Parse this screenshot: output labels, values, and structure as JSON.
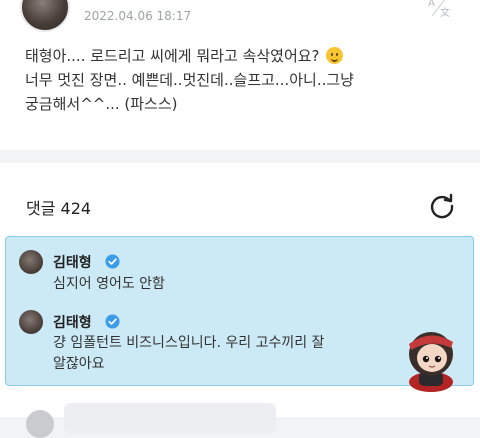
{
  "post": {
    "author": "",
    "date": "2022.04.06 18:17",
    "translate_icon": "translate-icon",
    "lines": [
      "태형아.... 로드리고 씨에게 뭐라고 속삭였어요?",
      "너무 멋진 장면.. 예쁜데..멋진데..슬프고...아니..그냥",
      "궁금해서^^... (파스스)"
    ],
    "emoji": "smiling-face-emoji"
  },
  "comments": {
    "title": "댓글 424",
    "refresh_icon": "refresh-icon",
    "items": [
      {
        "author": "김태형",
        "verified": true,
        "text_lines": [
          "심지어 영어도 안함"
        ]
      },
      {
        "author": "김태형",
        "verified": true,
        "text_lines": [
          "걍 임폴턴트 비즈니스입니다. 우리 고수끼리 잘",
          "알잖아요"
        ]
      }
    ],
    "sticker": "chibi-character-sticker"
  },
  "colors": {
    "highlight_bg": "#cce9f6",
    "highlight_border": "#8ccbe8",
    "verified_blue": "#3b9ce8",
    "page_bg": "#f2f3f5"
  }
}
